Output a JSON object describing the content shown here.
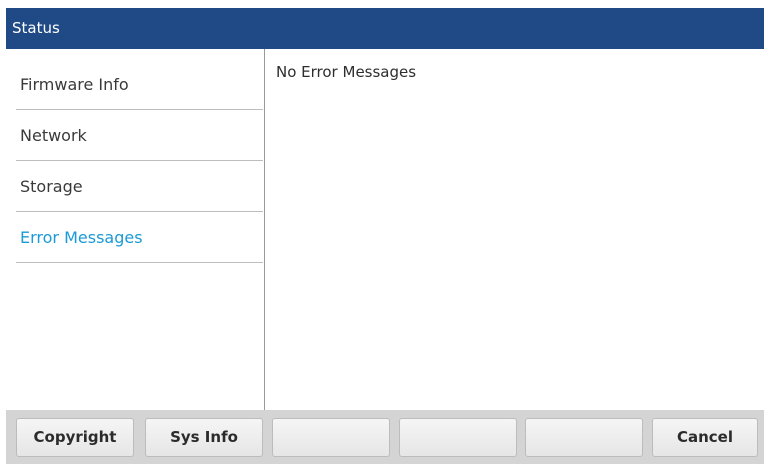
{
  "header": {
    "title": "Status"
  },
  "sidebar": {
    "items": [
      {
        "label": "Firmware Info",
        "active": false
      },
      {
        "label": "Network",
        "active": false
      },
      {
        "label": "Storage",
        "active": false
      },
      {
        "label": "Error Messages",
        "active": true
      }
    ]
  },
  "main": {
    "message": "No Error Messages"
  },
  "softkeys": [
    {
      "label": "Copyright"
    },
    {
      "label": "Sys Info"
    },
    {
      "label": ""
    },
    {
      "label": ""
    },
    {
      "label": ""
    },
    {
      "label": "Cancel"
    }
  ],
  "colors": {
    "title_bar": "#1f4a85",
    "active_item": "#1a9ad6",
    "softkey_bar": "#d4d4d4"
  }
}
